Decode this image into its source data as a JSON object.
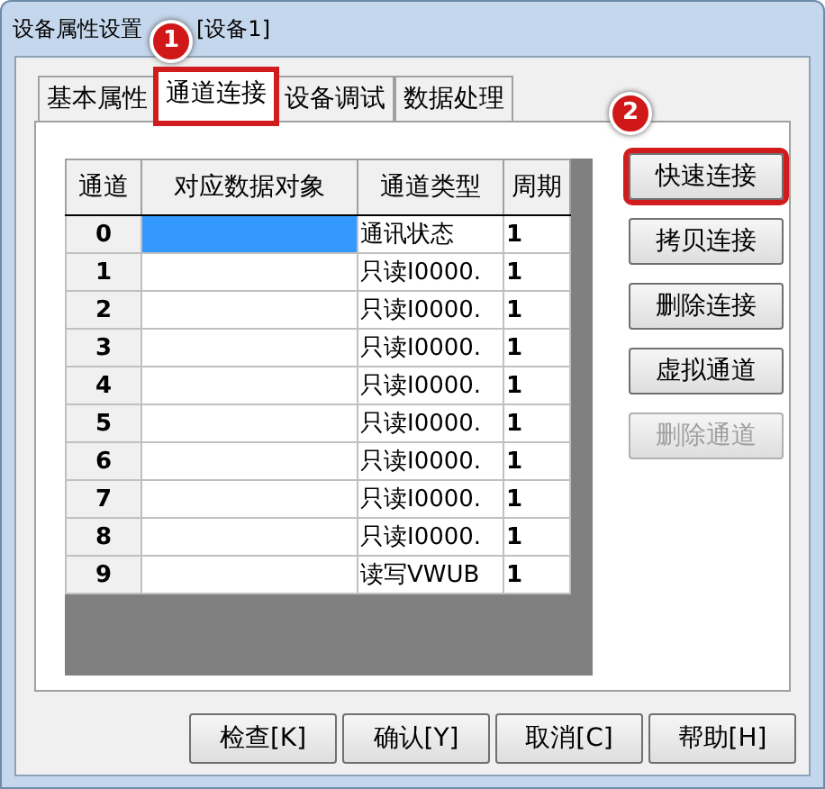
{
  "window": {
    "title": "设备属性设置",
    "subtitle": "[设备1]"
  },
  "tabs": [
    {
      "label": "基本属性",
      "selected": false,
      "highlighted": false
    },
    {
      "label": "通道连接",
      "selected": true,
      "highlighted": true
    },
    {
      "label": "设备调试",
      "selected": false,
      "highlighted": false
    },
    {
      "label": "数据处理",
      "selected": false,
      "highlighted": false
    }
  ],
  "table": {
    "columns": [
      "通道",
      "对应数据对象",
      "通道类型",
      "周期"
    ],
    "rows": [
      {
        "channel": "0",
        "object_selected": true,
        "type": "通讯状态",
        "period": "1"
      },
      {
        "channel": "1",
        "object_selected": false,
        "type": "只读I0000.",
        "period": "1"
      },
      {
        "channel": "2",
        "object_selected": false,
        "type": "只读I0000.",
        "period": "1"
      },
      {
        "channel": "3",
        "object_selected": false,
        "type": "只读I0000.",
        "period": "1"
      },
      {
        "channel": "4",
        "object_selected": false,
        "type": "只读I0000.",
        "period": "1"
      },
      {
        "channel": "5",
        "object_selected": false,
        "type": "只读I0000.",
        "period": "1"
      },
      {
        "channel": "6",
        "object_selected": false,
        "type": "只读I0000.",
        "period": "1"
      },
      {
        "channel": "7",
        "object_selected": false,
        "type": "只读I0000.",
        "period": "1"
      },
      {
        "channel": "8",
        "object_selected": false,
        "type": "只读I0000.",
        "period": "1"
      },
      {
        "channel": "9",
        "object_selected": false,
        "type": "读写VWUB",
        "period": "1"
      }
    ]
  },
  "side_buttons": [
    {
      "label": "快速连接",
      "disabled": false,
      "highlighted": true
    },
    {
      "label": "拷贝连接",
      "disabled": false,
      "highlighted": false
    },
    {
      "label": "删除连接",
      "disabled": false,
      "highlighted": false
    },
    {
      "label": "虚拟通道",
      "disabled": false,
      "highlighted": false
    },
    {
      "label": "删除通道",
      "disabled": true,
      "highlighted": false
    }
  ],
  "bottom_buttons": [
    {
      "label": "检查[K]"
    },
    {
      "label": "确认[Y]"
    },
    {
      "label": "取消[C]"
    },
    {
      "label": "帮助[H]"
    }
  ],
  "markers": [
    {
      "label": "1"
    },
    {
      "label": "2"
    }
  ]
}
